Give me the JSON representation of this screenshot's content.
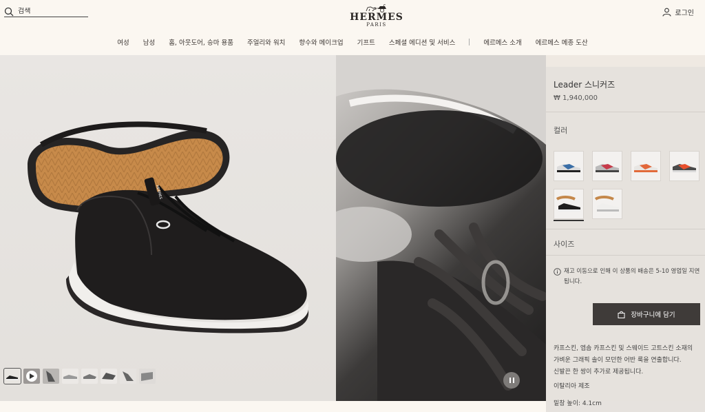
{
  "header": {
    "search_placeholder": "검색",
    "logo_main": "HERMES",
    "logo_sub": "PARIS",
    "login_label": "로그인"
  },
  "nav": {
    "items": [
      "여성",
      "남성",
      "홈, 아웃도어, 승마 용품",
      "주얼리와 워치",
      "향수와 메이크업",
      "기프트",
      "스페셜 에디션 및 서비스",
      "에르메스 소개",
      "에르메스 메종 도산"
    ]
  },
  "product": {
    "name": "Leader 스니커즈",
    "price": "₩ 1,940,000",
    "color_label": "컬러",
    "size_label": "사이즈",
    "notice": "재고 이동으로 인해 이 상품의 배송은 5-10 영업일 지연됩니다.",
    "cart_label": "장바구니에 담기",
    "description": [
      "카프스킨, 엡솜 카프스킨 및 스웨이드 고트스킨 소재의",
      "가벼운 그래픽 솔이 모던한 어반 룩을 연출합니다.",
      "신발끈 한 쌍이 추가로 제공됩니다."
    ],
    "origin": "이탈리아 제조",
    "sole_height": "밑창 높이: 4.1cm"
  },
  "colors": {
    "accent": "#3f3b39",
    "panel_bg": "#e5e1dd",
    "page_bg": "#fbf7f1"
  }
}
